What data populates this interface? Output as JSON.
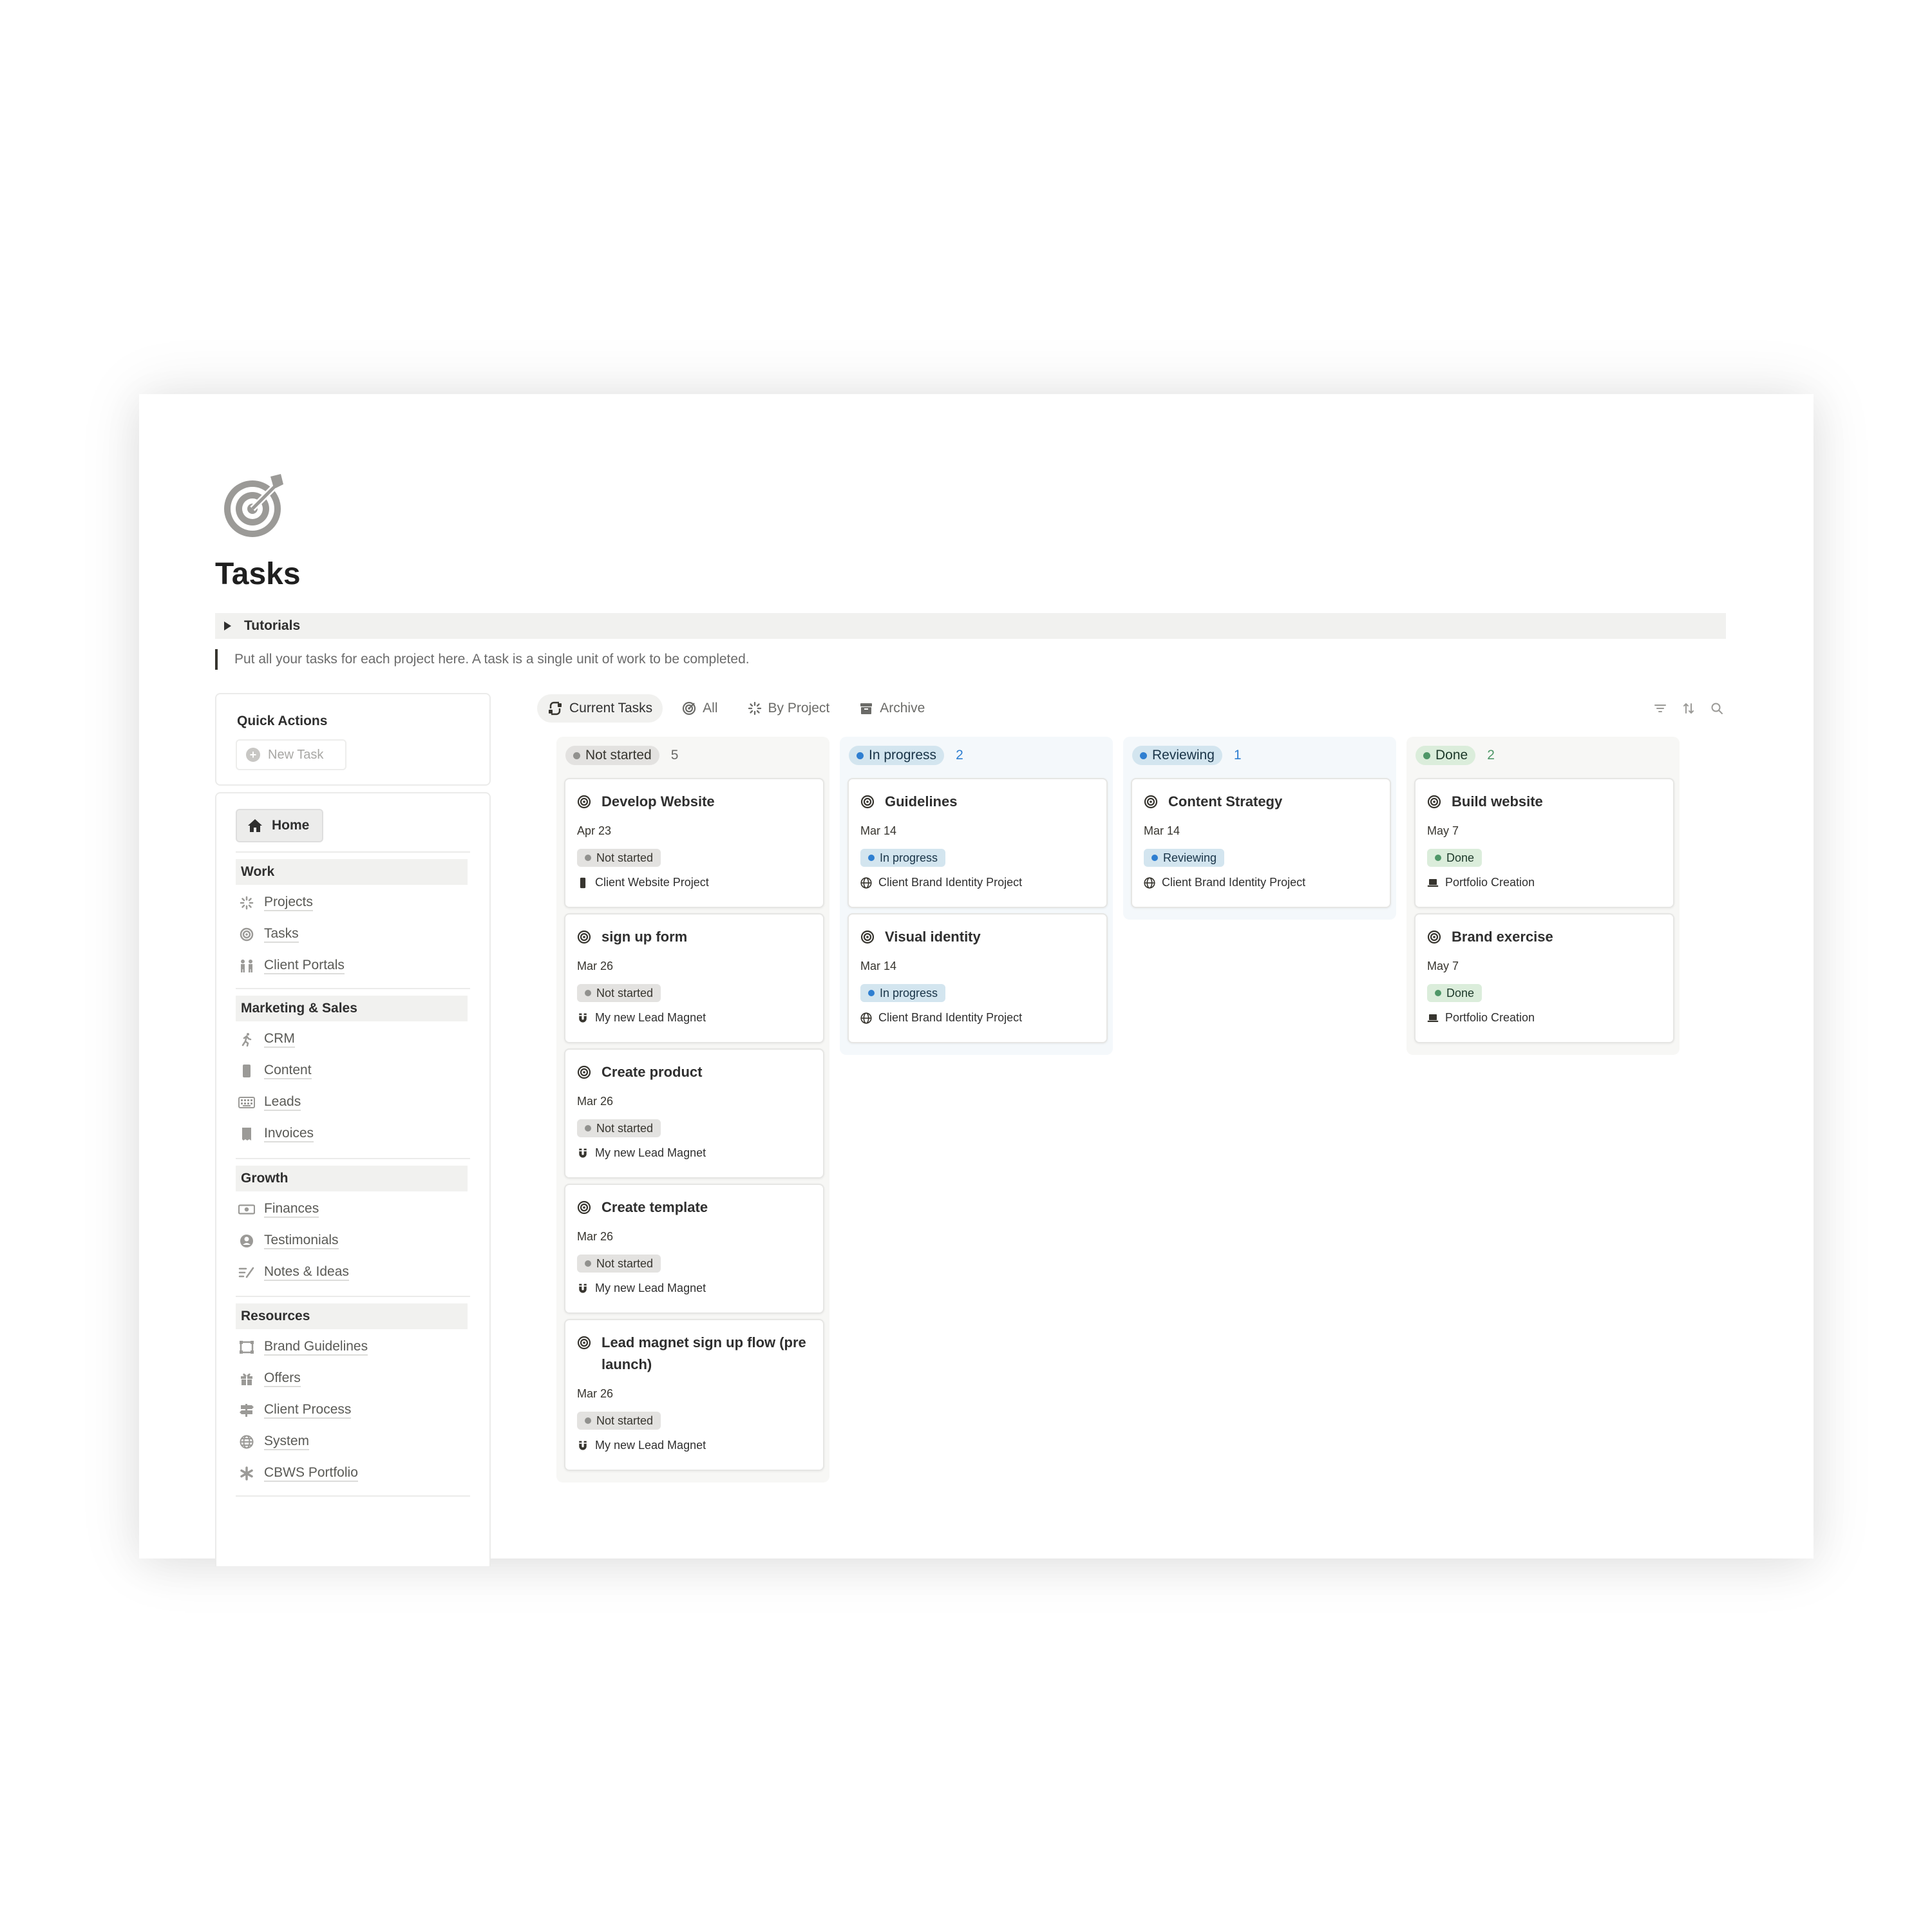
{
  "page": {
    "title": "Tasks",
    "icon": "target-icon",
    "toggle_label": "Tutorials",
    "description": "Put all your tasks for each project here. A task is a single unit of work to be completed."
  },
  "quick_actions": {
    "title": "Quick Actions",
    "new_task_label": "New Task"
  },
  "nav": {
    "home_label": "Home",
    "sections": [
      {
        "title": "Work",
        "items": [
          {
            "label": "Projects",
            "icon": "spinner-icon"
          },
          {
            "label": "Tasks",
            "icon": "target-icon"
          },
          {
            "label": "Client Portals",
            "icon": "people-icon"
          }
        ]
      },
      {
        "title": "Marketing & Sales",
        "items": [
          {
            "label": "CRM",
            "icon": "running-icon"
          },
          {
            "label": "Content",
            "icon": "phone-icon"
          },
          {
            "label": "Leads",
            "icon": "keyboard-icon"
          },
          {
            "label": "Invoices",
            "icon": "receipt-icon"
          }
        ]
      },
      {
        "title": "Growth",
        "items": [
          {
            "label": "Finances",
            "icon": "money-icon"
          },
          {
            "label": "Testimonials",
            "icon": "person-circle-icon"
          },
          {
            "label": "Notes & Ideas",
            "icon": "write-icon"
          }
        ]
      },
      {
        "title": "Resources",
        "items": [
          {
            "label": "Brand Guidelines",
            "icon": "frame-icon"
          },
          {
            "label": "Offers",
            "icon": "gift-icon"
          },
          {
            "label": "Client Process",
            "icon": "signpost-icon"
          },
          {
            "label": "System",
            "icon": "globe-icon"
          },
          {
            "label": "CBWS Portfolio",
            "icon": "asterisk-icon"
          }
        ]
      }
    ]
  },
  "views": {
    "tabs": [
      {
        "label": "Current Tasks",
        "icon": "current-tasks-icon"
      },
      {
        "label": "All",
        "icon": "target-icon"
      },
      {
        "label": "By Project",
        "icon": "spinner-icon"
      },
      {
        "label": "Archive",
        "icon": "archive-icon"
      }
    ],
    "tools": [
      "filter-icon",
      "sort-icon",
      "search-icon"
    ]
  },
  "colors": {
    "not_started_bg": "#e3e2e0",
    "not_started_dot": "#91918e",
    "not_started_col": "#f7f7f5",
    "in_progress_bg": "#d3e5ef",
    "in_progress_dot": "#2f7fd1",
    "in_progress_col": "#f4f8fb",
    "reviewing_bg": "#d3e5ef",
    "reviewing_dot": "#2f7fd1",
    "reviewing_col": "#f4f8fb",
    "done_bg": "#dbeddb",
    "done_dot": "#4f9768",
    "done_col": "#f7f7f5"
  },
  "board": {
    "columns": [
      {
        "status": "Not started",
        "count": "5",
        "cards": [
          {
            "title": "Develop Website",
            "date": "Apr 23",
            "status": "Not started",
            "project": "Client Website Project",
            "project_icon": "phone-icon"
          },
          {
            "title": "sign up form",
            "date": "Mar 26",
            "status": "Not started",
            "project": "My new Lead Magnet",
            "project_icon": "magnet-icon"
          },
          {
            "title": "Create product",
            "date": "Mar 26",
            "status": "Not started",
            "project": "My new Lead Magnet",
            "project_icon": "magnet-icon"
          },
          {
            "title": "Create template",
            "date": "Mar 26",
            "status": "Not started",
            "project": "My new Lead Magnet",
            "project_icon": "magnet-icon"
          },
          {
            "title": "Lead magnet sign up flow (pre launch)",
            "date": "Mar 26",
            "status": "Not started",
            "project": "My new Lead Magnet",
            "project_icon": "magnet-icon"
          }
        ]
      },
      {
        "status": "In progress",
        "count": "2",
        "cards": [
          {
            "title": "Guidelines",
            "date": "Mar 14",
            "status": "In progress",
            "project": "Client Brand Identity Project",
            "project_icon": "globe-icon"
          },
          {
            "title": "Visual identity",
            "date": "Mar 14",
            "status": "In progress",
            "project": "Client Brand Identity Project",
            "project_icon": "globe-icon"
          }
        ]
      },
      {
        "status": "Reviewing",
        "count": "1",
        "cards": [
          {
            "title": "Content Strategy",
            "date": "Mar 14",
            "status": "Reviewing",
            "project": "Client Brand Identity Project",
            "project_icon": "globe-icon"
          }
        ]
      },
      {
        "status": "Done",
        "count": "2",
        "cards": [
          {
            "title": "Build website",
            "date": "May 7",
            "status": "Done",
            "project": "Portfolio Creation",
            "project_icon": "laptop-icon"
          },
          {
            "title": "Brand exercise",
            "date": "May 7",
            "status": "Done",
            "project": "Portfolio Creation",
            "project_icon": "laptop-icon"
          }
        ]
      }
    ]
  }
}
